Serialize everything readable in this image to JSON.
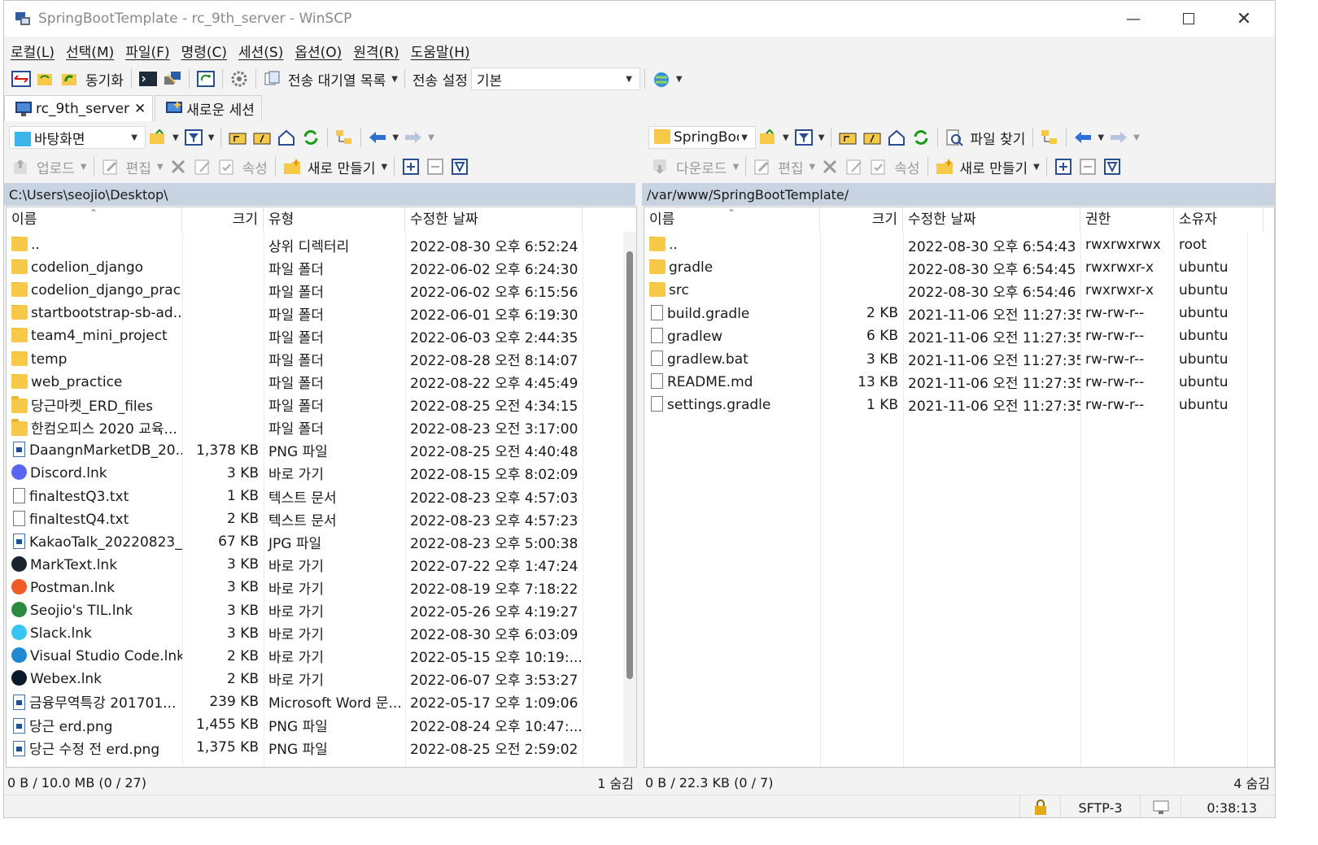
{
  "window": {
    "title": "SpringBootTemplate - rc_9th_server - WinSCP"
  },
  "menu": [
    "로컬(L)",
    "선택(M)",
    "파일(F)",
    "명령(C)",
    "세션(S)",
    "옵션(O)",
    "원격(R)",
    "도움말(H)"
  ],
  "toolbar": {
    "sync_label": "동기화",
    "queue_label": "전송 대기열 목록",
    "transfer_settings_label": "전송 설정",
    "transfer_preset": "기본"
  },
  "tabs": [
    {
      "label": "rc_9th_server"
    },
    {
      "label": "새로운 세션"
    }
  ],
  "left": {
    "location": "바탕화면",
    "upload_label": "업로드",
    "edit_label": "편집",
    "props_label": "속성",
    "new_label": "새로 만들기",
    "path": "C:\\Users\\seojio\\Desktop\\",
    "columns": {
      "name": "이름",
      "size": "크기",
      "type": "유형",
      "modified": "수정한 날짜"
    },
    "files": [
      {
        "name": "..",
        "size": "",
        "type": "상위 디렉터리",
        "modified": "2022-08-30  오후 6:52:24",
        "icon": "parent-folder"
      },
      {
        "name": "codelion_django",
        "size": "",
        "type": "파일 폴더",
        "modified": "2022-06-02  오후 6:24:30",
        "icon": "folder"
      },
      {
        "name": "codelion_django_prac...",
        "size": "",
        "type": "파일 폴더",
        "modified": "2022-06-02  오후 6:15:56",
        "icon": "folder"
      },
      {
        "name": "startbootstrap-sb-ad...",
        "size": "",
        "type": "파일 폴더",
        "modified": "2022-06-01  오후 6:19:30",
        "icon": "folder"
      },
      {
        "name": "team4_mini_project",
        "size": "",
        "type": "파일 폴더",
        "modified": "2022-06-03  오후 2:44:35",
        "icon": "folder"
      },
      {
        "name": "temp",
        "size": "",
        "type": "파일 폴더",
        "modified": "2022-08-28  오전 8:14:07",
        "icon": "folder"
      },
      {
        "name": "web_practice",
        "size": "",
        "type": "파일 폴더",
        "modified": "2022-08-22  오후 4:45:49",
        "icon": "folder"
      },
      {
        "name": "당근마켓_ERD_files",
        "size": "",
        "type": "파일 폴더",
        "modified": "2022-08-25  오전 4:34:15",
        "icon": "folder"
      },
      {
        "name": "한컴오피스 2020 교육...",
        "size": "",
        "type": "파일 폴더",
        "modified": "2022-08-23  오전 3:17:00",
        "icon": "folder"
      },
      {
        "name": "DaangnMarketDB_20...",
        "size": "1,378 KB",
        "type": "PNG 파일",
        "modified": "2022-08-25  오전 4:40:48",
        "icon": "image"
      },
      {
        "name": "Discord.lnk",
        "size": "3 KB",
        "type": "바로 가기",
        "modified": "2022-08-15  오후 8:02:09",
        "icon": "discord"
      },
      {
        "name": "finaltestQ3.txt",
        "size": "1 KB",
        "type": "텍스트 문서",
        "modified": "2022-08-23  오후 4:57:03",
        "icon": "text"
      },
      {
        "name": "finaltestQ4.txt",
        "size": "2 KB",
        "type": "텍스트 문서",
        "modified": "2022-08-23  오후 4:57:23",
        "icon": "text"
      },
      {
        "name": "KakaoTalk_20220823_...",
        "size": "67 KB",
        "type": "JPG 파일",
        "modified": "2022-08-23  오후 5:00:38",
        "icon": "image"
      },
      {
        "name": "MarkText.lnk",
        "size": "3 KB",
        "type": "바로 가기",
        "modified": "2022-07-22  오후 1:47:24",
        "icon": "marktext"
      },
      {
        "name": "Postman.lnk",
        "size": "3 KB",
        "type": "바로 가기",
        "modified": "2022-08-19  오후 7:18:22",
        "icon": "postman"
      },
      {
        "name": "Seojio's TIL.lnk",
        "size": "3 KB",
        "type": "바로 가기",
        "modified": "2022-05-26  오후 4:19:27",
        "icon": "shortcut"
      },
      {
        "name": "Slack.lnk",
        "size": "3 KB",
        "type": "바로 가기",
        "modified": "2022-08-30  오후 6:03:09",
        "icon": "slack"
      },
      {
        "name": "Visual Studio Code.lnk",
        "size": "2 KB",
        "type": "바로 가기",
        "modified": "2022-05-15  오후 10:19:...",
        "icon": "vscode"
      },
      {
        "name": "Webex.lnk",
        "size": "2 KB",
        "type": "바로 가기",
        "modified": "2022-06-07  오후 3:53:27",
        "icon": "webex"
      },
      {
        "name": "금융무역특강 201701...",
        "size": "239 KB",
        "type": "Microsoft Word 문...",
        "modified": "2022-05-17  오후 1:09:06",
        "icon": "word"
      },
      {
        "name": "당근 erd.png",
        "size": "1,455 KB",
        "type": "PNG 파일",
        "modified": "2022-08-24  오후 10:47:...",
        "icon": "image"
      },
      {
        "name": "당근 수정 전 erd.png",
        "size": "1,375 KB",
        "type": "PNG 파일",
        "modified": "2022-08-25  오전 2:59:02",
        "icon": "image"
      }
    ],
    "status": "0 B / 10.0 MB (0 / 27)",
    "hidden": "1 숨김"
  },
  "right": {
    "location": "SpringBoo",
    "download_label": "다운로드",
    "edit_label": "편집",
    "props_label": "속성",
    "new_label": "새로 만들기",
    "find_label": "파일 찾기",
    "path": "/var/www/SpringBootTemplate/",
    "columns": {
      "name": "이름",
      "size": "크기",
      "modified": "수정한 날짜",
      "rights": "권한",
      "owner": "소유자"
    },
    "files": [
      {
        "name": "..",
        "size": "",
        "modified": "2022-08-30  오후 6:54:43",
        "rights": "rwxrwxrwx",
        "owner": "root",
        "icon": "parent-folder"
      },
      {
        "name": "gradle",
        "size": "",
        "modified": "2022-08-30  오후 6:54:45",
        "rights": "rwxrwxr-x",
        "owner": "ubuntu",
        "icon": "folder"
      },
      {
        "name": "src",
        "size": "",
        "modified": "2022-08-30  오후 6:54:46",
        "rights": "rwxrwxr-x",
        "owner": "ubuntu",
        "icon": "folder"
      },
      {
        "name": "build.gradle",
        "size": "2 KB",
        "modified": "2021-11-06  오전 11:27:35",
        "rights": "rw-rw-r--",
        "owner": "ubuntu",
        "icon": "text"
      },
      {
        "name": "gradlew",
        "size": "6 KB",
        "modified": "2021-11-06  오전 11:27:35",
        "rights": "rw-rw-r--",
        "owner": "ubuntu",
        "icon": "file"
      },
      {
        "name": "gradlew.bat",
        "size": "3 KB",
        "modified": "2021-11-06  오전 11:27:35",
        "rights": "rw-rw-r--",
        "owner": "ubuntu",
        "icon": "bat"
      },
      {
        "name": "README.md",
        "size": "13 KB",
        "modified": "2021-11-06  오전 11:27:35",
        "rights": "rw-rw-r--",
        "owner": "ubuntu",
        "icon": "text"
      },
      {
        "name": "settings.gradle",
        "size": "1 KB",
        "modified": "2021-11-06  오전 11:27:35",
        "rights": "rw-rw-r--",
        "owner": "ubuntu",
        "icon": "text"
      }
    ],
    "status": "0 B / 22.3 KB (0 / 7)",
    "hidden": "4 숨김"
  },
  "statusbar": {
    "protocol": "SFTP-3",
    "elapsed": "0:38:13"
  }
}
